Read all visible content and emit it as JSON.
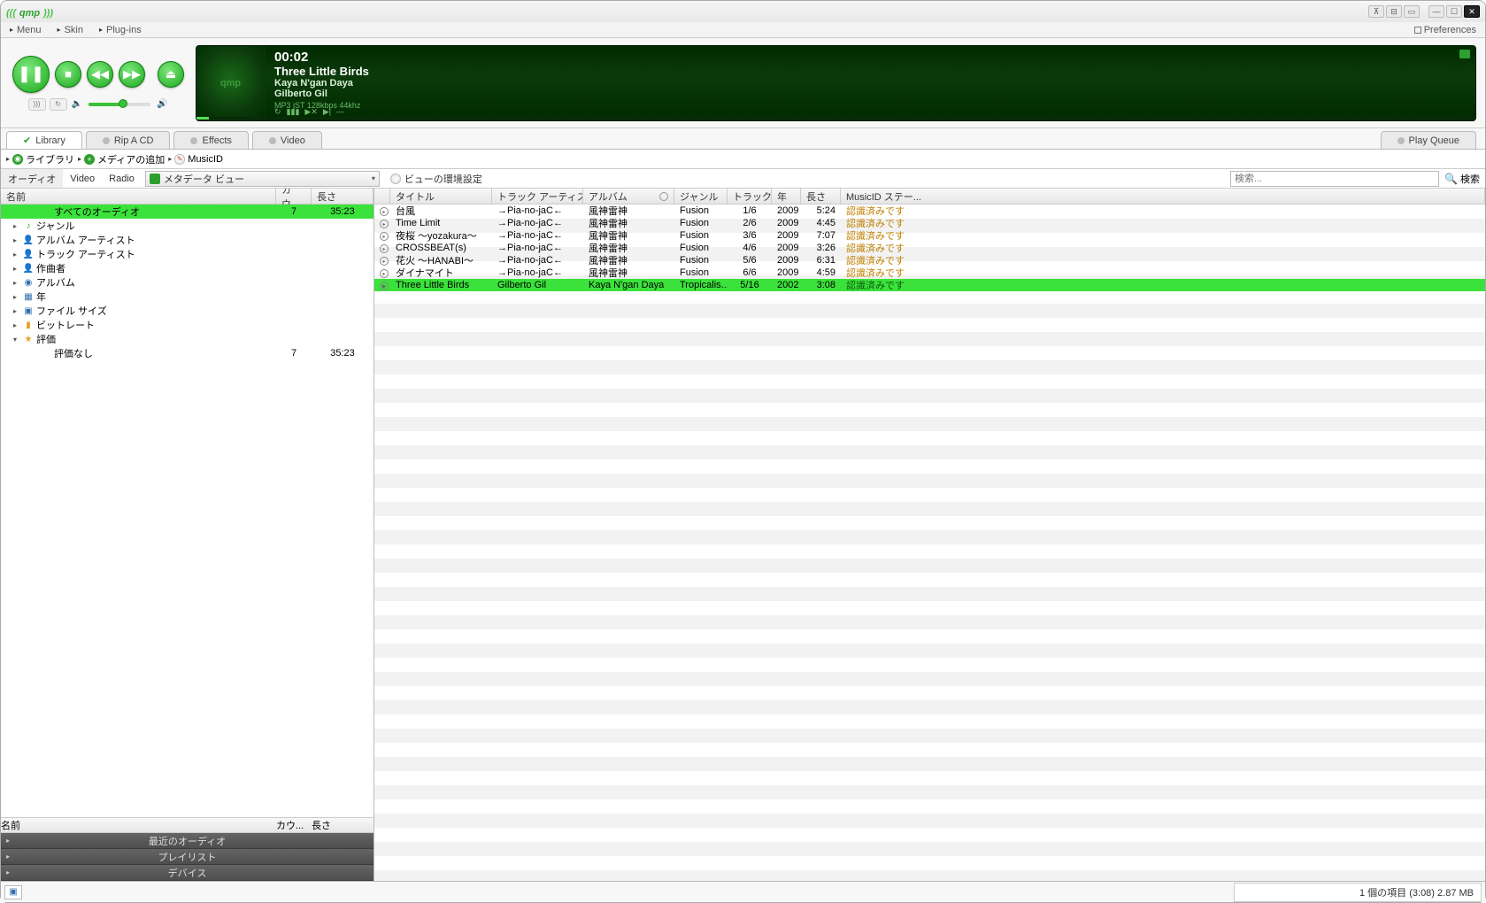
{
  "app": {
    "name": "qmp"
  },
  "menubar": {
    "menu": "Menu",
    "skin": "Skin",
    "plugins": "Plug-ins",
    "preferences": "Preferences"
  },
  "player": {
    "time": "00:02",
    "title": "Three Little Birds",
    "album": "Kaya N'gan Daya",
    "artist": "Gilberto Gil",
    "codec": "MP3 jST 128kbps 44khz",
    "art_label": "qmp"
  },
  "tabs": {
    "library": "Library",
    "rip": "Rip A CD",
    "effects": "Effects",
    "video": "Video",
    "playqueue": "Play Queue"
  },
  "breadcrumb": {
    "library": "ライブラリ",
    "add_media": "メディアの追加",
    "musicid": "MusicID"
  },
  "filters": {
    "audio": "オーディオ",
    "video": "Video",
    "radio": "Radio",
    "view": "メタデータ ビュー",
    "view_prefs": "ビューの環境設定",
    "search_placeholder": "検索...",
    "search_btn": "検索"
  },
  "tree": {
    "headers": {
      "name": "名前",
      "count": "カウ...",
      "length": "長さ"
    },
    "rows": [
      {
        "exp": "",
        "ico": "",
        "label": "すべてのオーディオ",
        "count": "7",
        "length": "35:23",
        "indent": 3,
        "selected": true
      },
      {
        "exp": "▸",
        "ico": "♪",
        "cls": "note",
        "label": "ジャンル",
        "indent": 1
      },
      {
        "exp": "▸",
        "ico": "👤",
        "cls": "person",
        "label": "アルバム アーティスト",
        "indent": 1
      },
      {
        "exp": "▸",
        "ico": "👤",
        "cls": "person",
        "label": "トラック アーティスト",
        "indent": 1
      },
      {
        "exp": "▸",
        "ico": "👤",
        "cls": "person",
        "label": "作曲者",
        "indent": 1
      },
      {
        "exp": "▸",
        "ico": "◉",
        "cls": "album",
        "label": "アルバム",
        "indent": 1
      },
      {
        "exp": "▸",
        "ico": "▦",
        "cls": "cal",
        "label": "年",
        "indent": 1
      },
      {
        "exp": "▸",
        "ico": "▣",
        "cls": "file",
        "label": "ファイル サイズ",
        "indent": 1
      },
      {
        "exp": "▸",
        "ico": "▮",
        "cls": "bars",
        "label": "ビットレート",
        "indent": 1
      },
      {
        "exp": "▾",
        "ico": "★",
        "cls": "star",
        "label": "評価",
        "indent": 1
      },
      {
        "exp": "",
        "ico": "",
        "label": "評価なし",
        "count": "7",
        "length": "35:23",
        "indent": 3
      }
    ],
    "bottom_hdr": {
      "name": "名前",
      "count": "カウ...",
      "length": "長さ"
    },
    "bottom_rows": [
      "最近のオーディオ",
      "プレイリスト",
      "デバイス"
    ]
  },
  "tracks": {
    "headers": {
      "title": "タイトル",
      "artist": "トラック アーティスト",
      "album": "アルバム",
      "genre": "ジャンル",
      "trackno": "トラック #",
      "year": "年",
      "length": "長さ",
      "musicid": "MusicID ステー..."
    },
    "rows": [
      {
        "title": "台風",
        "artist": "→Pia-no-jaC←",
        "album": "風神雷神",
        "genre": "Fusion",
        "trackno": "1/6",
        "year": "2009",
        "length": "5:24",
        "musicid": "認識済みです"
      },
      {
        "title": "Time Limit",
        "artist": "→Pia-no-jaC←",
        "album": "風神雷神",
        "genre": "Fusion",
        "trackno": "2/6",
        "year": "2009",
        "length": "4:45",
        "musicid": "認識済みです"
      },
      {
        "title": "夜桜 ～yozakura～",
        "artist": "→Pia-no-jaC←",
        "album": "風神雷神",
        "genre": "Fusion",
        "trackno": "3/6",
        "year": "2009",
        "length": "7:07",
        "musicid": "認識済みです"
      },
      {
        "title": "CROSSBEAT(s)",
        "artist": "→Pia-no-jaC←",
        "album": "風神雷神",
        "genre": "Fusion",
        "trackno": "4/6",
        "year": "2009",
        "length": "3:26",
        "musicid": "認識済みです"
      },
      {
        "title": "花火 ～HANABI～",
        "artist": "→Pia-no-jaC←",
        "album": "風神雷神",
        "genre": "Fusion",
        "trackno": "5/6",
        "year": "2009",
        "length": "6:31",
        "musicid": "認識済みです"
      },
      {
        "title": "ダイナマイト",
        "artist": "→Pia-no-jaC←",
        "album": "風神雷神",
        "genre": "Fusion",
        "trackno": "6/6",
        "year": "2009",
        "length": "4:59",
        "musicid": "認識済みです"
      },
      {
        "title": "Three Little Birds",
        "artist": "Gilberto Gil",
        "album": "Kaya N'gan Daya",
        "genre": "Tropicalis...",
        "trackno": "5/16",
        "year": "2002",
        "length": "3:08",
        "musicid": "認識済みです",
        "playing": true
      }
    ]
  },
  "statusbar": {
    "info": "1 個の項目 (3:08) 2.87 MB"
  }
}
